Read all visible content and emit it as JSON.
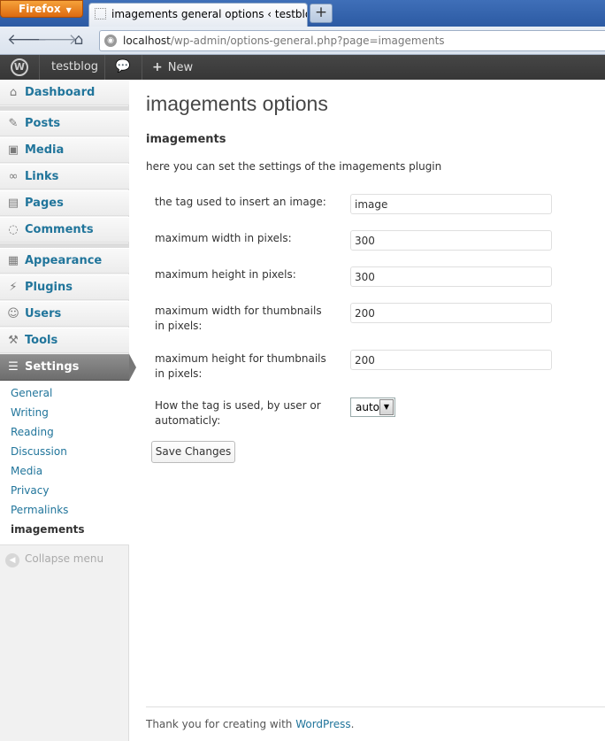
{
  "browser": {
    "app_button": "Firefox",
    "tab_title": "imagements general options ‹ testblog ...",
    "url_host": "localhost",
    "url_path": "/wp-admin/options-general.php?page=imagements",
    "icons": {
      "back": "back-arrow-icon",
      "forward": "forward-arrow-icon",
      "home": "home-icon",
      "new_tab": "plus-icon"
    }
  },
  "adminbar": {
    "site_name": "testblog",
    "new_label": "New"
  },
  "sidebar": {
    "items": [
      {
        "label": "Dashboard",
        "icon": "dashboard-icon"
      },
      {
        "label": "Posts",
        "icon": "pushpin-icon"
      },
      {
        "label": "Media",
        "icon": "media-icon"
      },
      {
        "label": "Links",
        "icon": "link-icon"
      },
      {
        "label": "Pages",
        "icon": "page-icon"
      },
      {
        "label": "Comments",
        "icon": "comment-icon"
      },
      {
        "label": "Appearance",
        "icon": "appearance-icon"
      },
      {
        "label": "Plugins",
        "icon": "plugin-icon"
      },
      {
        "label": "Users",
        "icon": "users-icon"
      },
      {
        "label": "Tools",
        "icon": "tools-icon"
      },
      {
        "label": "Settings",
        "icon": "settings-icon"
      }
    ],
    "settings_submenu": [
      "General",
      "Writing",
      "Reading",
      "Discussion",
      "Media",
      "Privacy",
      "Permalinks",
      "imagements"
    ],
    "collapse_label": "Collapse menu"
  },
  "main": {
    "title": "imagements options",
    "section_title": "imagements",
    "intro": "here you can set the settings of the imagements plugin",
    "fields": [
      {
        "label": "the tag used to insert an image:",
        "value": "image"
      },
      {
        "label": "maximum width in pixels:",
        "value": "300"
      },
      {
        "label": "maximum height in pixels:",
        "value": "300"
      },
      {
        "label": "maximum width for thumbnails in pixels:",
        "value": "200"
      },
      {
        "label": "maximum height for thumbnails in pixels:",
        "value": "200"
      }
    ],
    "mode_label": "How the tag is used, by user or automaticly:",
    "mode_value": "auto",
    "save_label": "Save Changes"
  },
  "footer": {
    "text": "Thank you for creating with ",
    "link": "WordPress",
    "end": "."
  },
  "colors": {
    "link": "#21759b",
    "adminbar": "#464646",
    "current_menu": "#777777"
  }
}
